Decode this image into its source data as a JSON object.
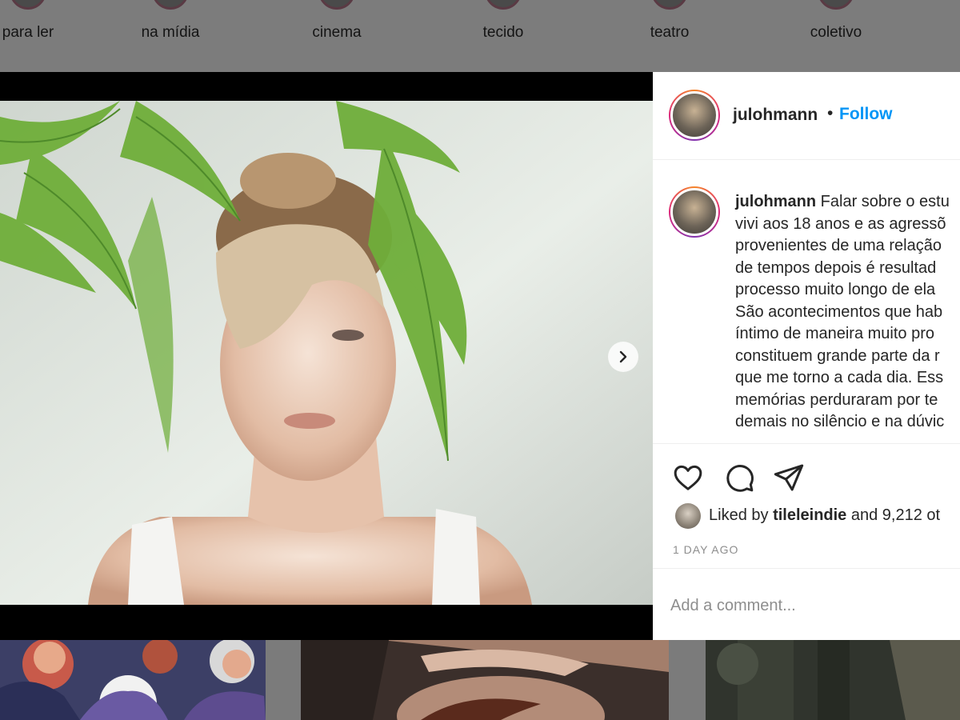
{
  "highlights": [
    {
      "label": "para ler"
    },
    {
      "label": "na mídia"
    },
    {
      "label": "cinema"
    },
    {
      "label": "tecido"
    },
    {
      "label": "teatro"
    },
    {
      "label": "coletivo"
    }
  ],
  "post": {
    "username": "julohmann",
    "separator": "•",
    "follow_label": "Follow",
    "caption_lines": [
      "Falar sobre o estu",
      "vivi aos 18 anos e as agressõ",
      "provenientes de uma relação",
      "de tempos depois é resultad",
      "processo muito longo de ela",
      "São acontecimentos que hab",
      "íntimo de maneira muito pro",
      "constituem grande parte da r",
      "que me torno a cada dia. Ess",
      "memórias perduraram por te",
      "demais no silêncio e na dúvic"
    ],
    "likes": {
      "prefix": "Liked by",
      "user": "tileleindie",
      "suffix": "and 9,212 ot"
    },
    "timestamp": "1 DAY AGO",
    "comment_placeholder": "Add a comment..."
  },
  "icons": {
    "like": "heart-icon",
    "comment": "comment-icon",
    "share": "send-icon",
    "next": "chevron-right-icon"
  },
  "colors": {
    "link_blue": "#0095f6",
    "text": "#262626",
    "muted": "#8e8e8e"
  }
}
